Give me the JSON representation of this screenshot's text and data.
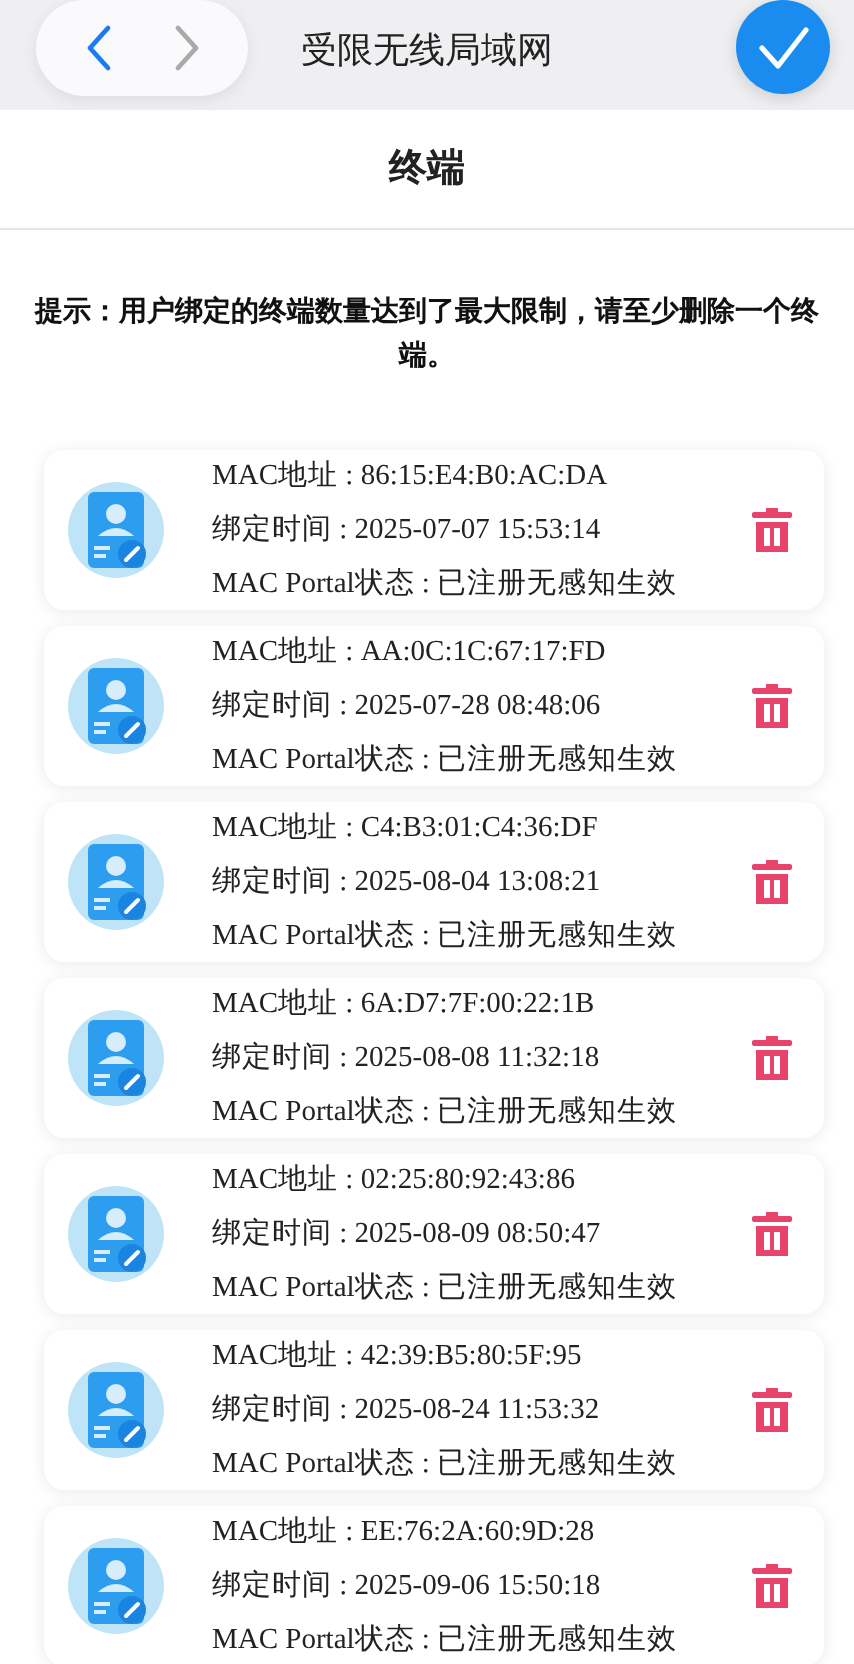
{
  "nav_bar": {
    "title": "受限无线局域网"
  },
  "header": {
    "title": "终端"
  },
  "hint": "提示：用户绑定的终端数量达到了最大限制，请至少删除一个终端。",
  "devices": [
    {
      "mac": "MAC地址 : 86:15:E4:B0:AC:DA",
      "bind_time": "绑定时间 : 2025-07-07 15:53:14",
      "portal_status": "MAC Portal状态 : 已注册无感知生效"
    },
    {
      "mac": "MAC地址 : AA:0C:1C:67:17:FD",
      "bind_time": "绑定时间 : 2025-07-28 08:48:06",
      "portal_status": "MAC Portal状态 : 已注册无感知生效"
    },
    {
      "mac": "MAC地址 : C4:B3:01:C4:36:DF",
      "bind_time": "绑定时间 : 2025-08-04 13:08:21",
      "portal_status": "MAC Portal状态 : 已注册无感知生效"
    },
    {
      "mac": "MAC地址 : 6A:D7:7F:00:22:1B",
      "bind_time": "绑定时间 : 2025-08-08 11:32:18",
      "portal_status": "MAC Portal状态 : 已注册无感知生效"
    },
    {
      "mac": "MAC地址 : 02:25:80:92:43:86",
      "bind_time": "绑定时间 : 2025-08-09 08:50:47",
      "portal_status": "MAC Portal状态 : 已注册无感知生效"
    },
    {
      "mac": "MAC地址 : 42:39:B5:80:5F:95",
      "bind_time": "绑定时间 : 2025-08-24 11:53:32",
      "portal_status": "MAC Portal状态 : 已注册无感知生效"
    },
    {
      "mac": "MAC地址 : EE:76:2A:60:9D:28",
      "bind_time": "绑定时间 : 2025-09-06 15:50:18",
      "portal_status": "MAC Portal状态 : 已注册无感知生效"
    }
  ]
}
